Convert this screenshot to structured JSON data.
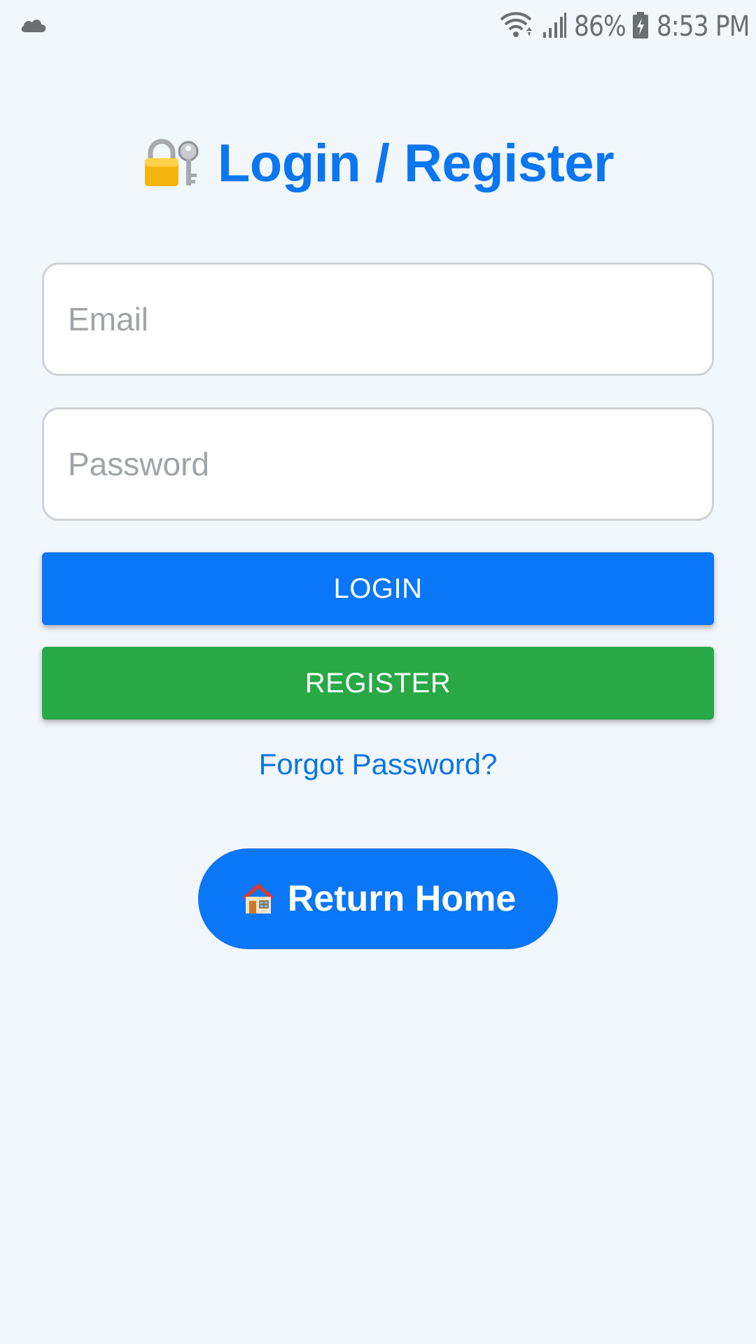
{
  "status_bar": {
    "battery_percent": "86%",
    "time": "8:53 PM",
    "icons": [
      "cloud-icon",
      "wifi-icon",
      "signal-icon",
      "battery-icon"
    ]
  },
  "header": {
    "title": "Login / Register",
    "icon": "lock-key-icon"
  },
  "form": {
    "email_placeholder": "Email",
    "email_value": "",
    "password_placeholder": "Password",
    "password_value": "",
    "login_label": "LOGIN",
    "register_label": "REGISTER",
    "forgot_label": "Forgot Password?"
  },
  "home": {
    "label": "Return Home",
    "icon": "house-icon"
  },
  "colors": {
    "background": "#f2f6fd",
    "primary": "#0a76f8",
    "success": "#29a846",
    "link": "#0a76e6"
  }
}
